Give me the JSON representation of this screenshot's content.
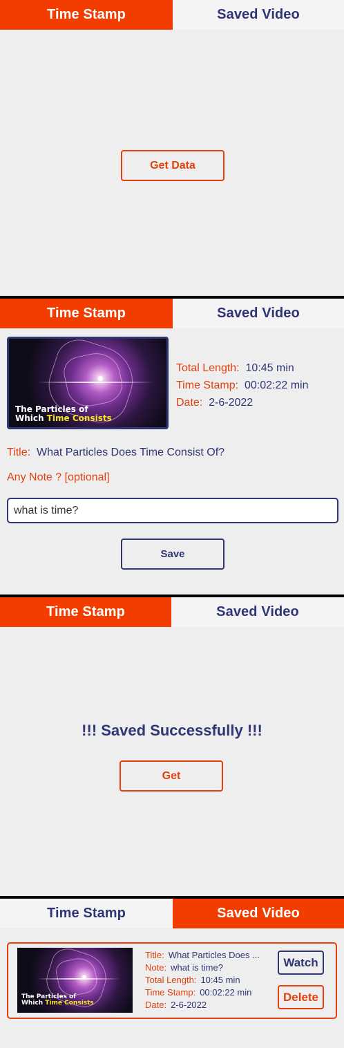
{
  "tabs": {
    "time_stamp": "Time Stamp",
    "saved_video": "Saved Video"
  },
  "panel1": {
    "get_data_button": "Get Data"
  },
  "panel2": {
    "thumbnail_caption_line1": "The Particles of",
    "thumbnail_caption_line2_white": "Which ",
    "thumbnail_caption_line2_yellow": "Time Consists",
    "total_length_label": "Total Length:",
    "total_length_value": "10:45 min",
    "time_stamp_label": "Time Stamp:",
    "time_stamp_value": "00:02:22 min",
    "date_label": "Date:",
    "date_value": "2-6-2022",
    "title_label": "Title:",
    "title_value": "What Particles Does Time Consist Of?",
    "note_heading": "Any Note ? [optional]",
    "note_input_value": "what is time?",
    "save_button": "Save"
  },
  "panel3": {
    "success_message": "!!! Saved Successfully !!!",
    "get_button": "Get"
  },
  "panel4": {
    "title_label": "Title:",
    "title_value": "What Particles Does ...",
    "note_label": "Note:",
    "note_value": "what is time?",
    "total_length_label": "Total Length:",
    "total_length_value": "10:45 min",
    "time_stamp_label": "Time Stamp:",
    "time_stamp_value": "00:02:22 min",
    "date_label": "Date:",
    "date_value": "2-6-2022",
    "watch_button": "Watch",
    "delete_button": "Delete"
  },
  "colors": {
    "accent": "#f23c00",
    "navy": "#2f3575",
    "background": "#eeeeee",
    "highlight": "#f7e321"
  }
}
